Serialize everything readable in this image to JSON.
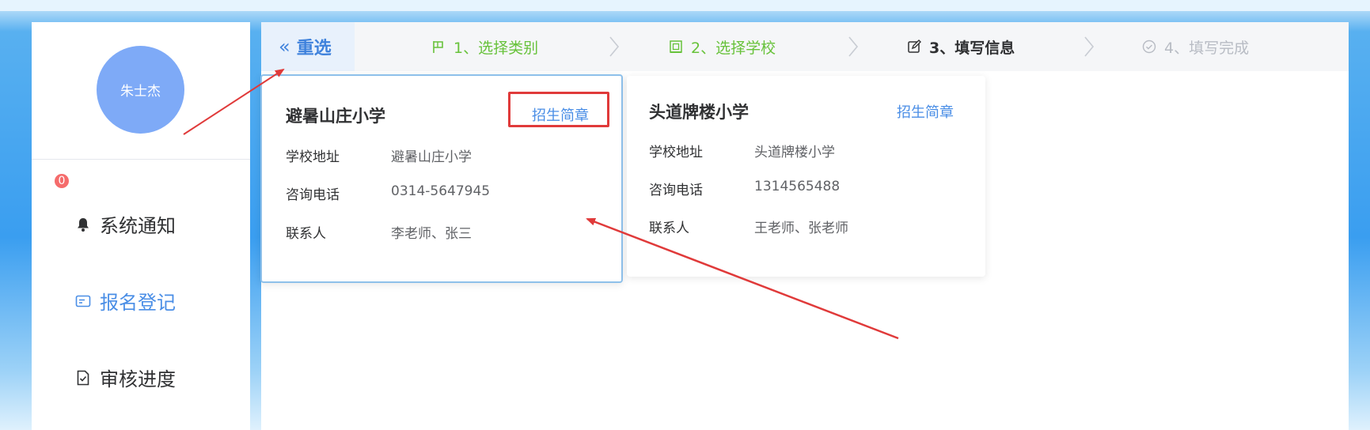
{
  "user": {
    "name": "朱士杰"
  },
  "sidebar": {
    "notification_count": "0",
    "items": [
      {
        "label": "系统通知",
        "icon": "bell-icon"
      },
      {
        "label": "报名登记",
        "icon": "id-card-icon",
        "active": true
      },
      {
        "label": "审核进度",
        "icon": "document-check-icon"
      }
    ]
  },
  "stepbar": {
    "reselect_icon": "double-chevron-left-icon",
    "reselect_label": "重选",
    "steps": [
      {
        "label": "1、选择类别",
        "icon": "flag-icon",
        "state": "done"
      },
      {
        "label": "2、选择学校",
        "icon": "grid-icon",
        "state": "done"
      },
      {
        "label": "3、填写信息",
        "icon": "edit-icon",
        "state": "current"
      },
      {
        "label": "4、填写完成",
        "icon": "check-circle-icon",
        "state": "pending"
      }
    ]
  },
  "schools": [
    {
      "name": "避暑山庄小学",
      "brochure_label": "招生简章",
      "address_label": "学校地址",
      "address": "避暑山庄小学",
      "phone_label": "咨询电话",
      "phone": "0314-5647945",
      "contact_label": "联系人",
      "contact": "李老师、张三",
      "selected": true
    },
    {
      "name": "头道牌楼小学",
      "brochure_label": "招生简章",
      "address_label": "学校地址",
      "address": "头道牌楼小学",
      "phone_label": "咨询电话",
      "phone": "1314565488",
      "contact_label": "联系人",
      "contact": "王老师、张老师",
      "selected": false
    }
  ],
  "colors": {
    "accent": "#4a8ee6",
    "done": "#67c23a",
    "pending": "#b8bcc4",
    "annotation": "#e03a3a",
    "badge": "#f56c6c"
  }
}
